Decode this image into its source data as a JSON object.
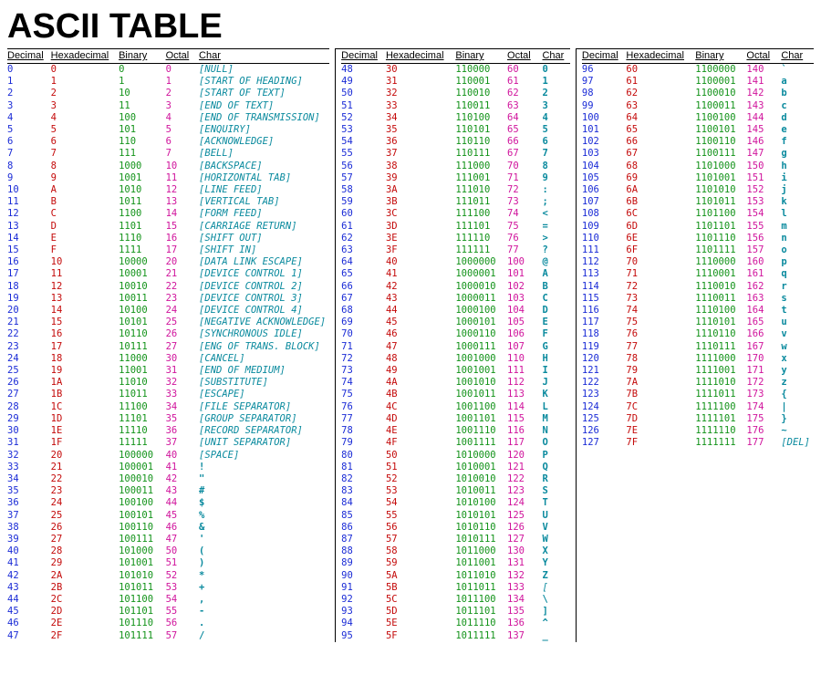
{
  "title": "ASCII TABLE",
  "headers": [
    "Decimal",
    "Hexadecimal",
    "Binary",
    "Octal",
    "Char"
  ],
  "chars": [
    "[NULL]",
    "[START OF HEADING]",
    "[START OF TEXT]",
    "[END OF TEXT]",
    "[END OF TRANSMISSION]",
    "[ENQUIRY]",
    "[ACKNOWLEDGE]",
    "[BELL]",
    "[BACKSPACE]",
    "[HORIZONTAL TAB]",
    "[LINE FEED]",
    "[VERTICAL TAB]",
    "[FORM FEED]",
    "[CARRIAGE RETURN]",
    "[SHIFT OUT]",
    "[SHIFT IN]",
    "[DATA LINK ESCAPE]",
    "[DEVICE CONTROL 1]",
    "[DEVICE CONTROL 2]",
    "[DEVICE CONTROL 3]",
    "[DEVICE CONTROL 4]",
    "[NEGATIVE ACKNOWLEDGE]",
    "[SYNCHRONOUS IDLE]",
    "[ENG OF TRANS. BLOCK]",
    "[CANCEL]",
    "[END OF MEDIUM]",
    "[SUBSTITUTE]",
    "[ESCAPE]",
    "[FILE SEPARATOR]",
    "[GROUP SEPARATOR]",
    "[RECORD SEPARATOR]",
    "[UNIT SEPARATOR]",
    "[SPACE]",
    "!",
    "\"",
    "#",
    "$",
    "%",
    "&",
    "'",
    "(",
    ")",
    "*",
    "+",
    ",",
    "-",
    ".",
    "/",
    "0",
    "1",
    "2",
    "3",
    "4",
    "5",
    "6",
    "7",
    "8",
    "9",
    ":",
    ";",
    "<",
    "=",
    ">",
    "?",
    "@",
    "A",
    "B",
    "C",
    "D",
    "E",
    "F",
    "G",
    "H",
    "I",
    "J",
    "K",
    "L",
    "M",
    "N",
    "O",
    "P",
    "Q",
    "R",
    "S",
    "T",
    "U",
    "V",
    "W",
    "X",
    "Y",
    "Z",
    "[",
    "\\",
    "]",
    "^",
    "_",
    "`",
    "a",
    "b",
    "c",
    "d",
    "e",
    "f",
    "g",
    "h",
    "i",
    "j",
    "k",
    "l",
    "m",
    "n",
    "o",
    "p",
    "q",
    "r",
    "s",
    "t",
    "u",
    "v",
    "w",
    "x",
    "y",
    "z",
    "{",
    "|",
    "}",
    "~",
    "[DEL]"
  ],
  "col_breaks": [
    0,
    48,
    96,
    128
  ]
}
